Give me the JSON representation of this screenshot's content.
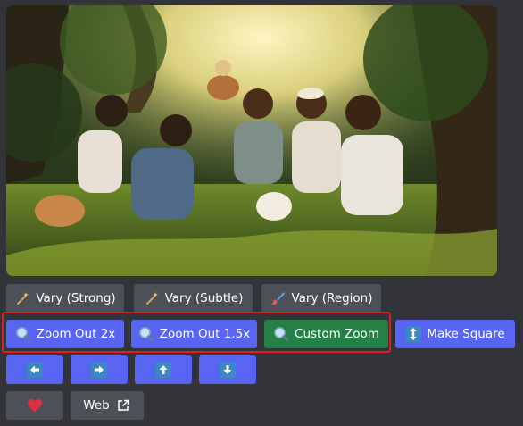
{
  "image": {
    "alt_icon": "generated-image"
  },
  "buttons": {
    "vary_strong": {
      "label": "Vary (Strong)",
      "icon": "magic-wand-icon"
    },
    "vary_subtle": {
      "label": "Vary (Subtle)",
      "icon": "magic-wand-icon"
    },
    "vary_region": {
      "label": "Vary (Region)",
      "icon": "paintbrush-icon"
    },
    "zoom_out_2x": {
      "label": "Zoom Out 2x",
      "icon": "magnifier-icon"
    },
    "zoom_out_15x": {
      "label": "Zoom Out 1.5x",
      "icon": "magnifier-icon"
    },
    "custom_zoom": {
      "label": "Custom Zoom",
      "icon": "magnifier-icon"
    },
    "make_square": {
      "label": "Make Square",
      "icon": "up-down-arrow-icon"
    },
    "pan_left": {
      "icon": "arrow-left-icon"
    },
    "pan_right": {
      "icon": "arrow-right-icon"
    },
    "pan_up": {
      "icon": "arrow-up-icon"
    },
    "pan_down": {
      "icon": "arrow-down-icon"
    },
    "favorite": {
      "icon": "heart-icon"
    },
    "web": {
      "label": "Web",
      "icon": "external-link-icon"
    }
  },
  "colors": {
    "background": "#323439",
    "gray_button": "#4e5058",
    "blurple_button": "#5865f2",
    "green_button": "#248046",
    "highlight": "#e11d24"
  }
}
